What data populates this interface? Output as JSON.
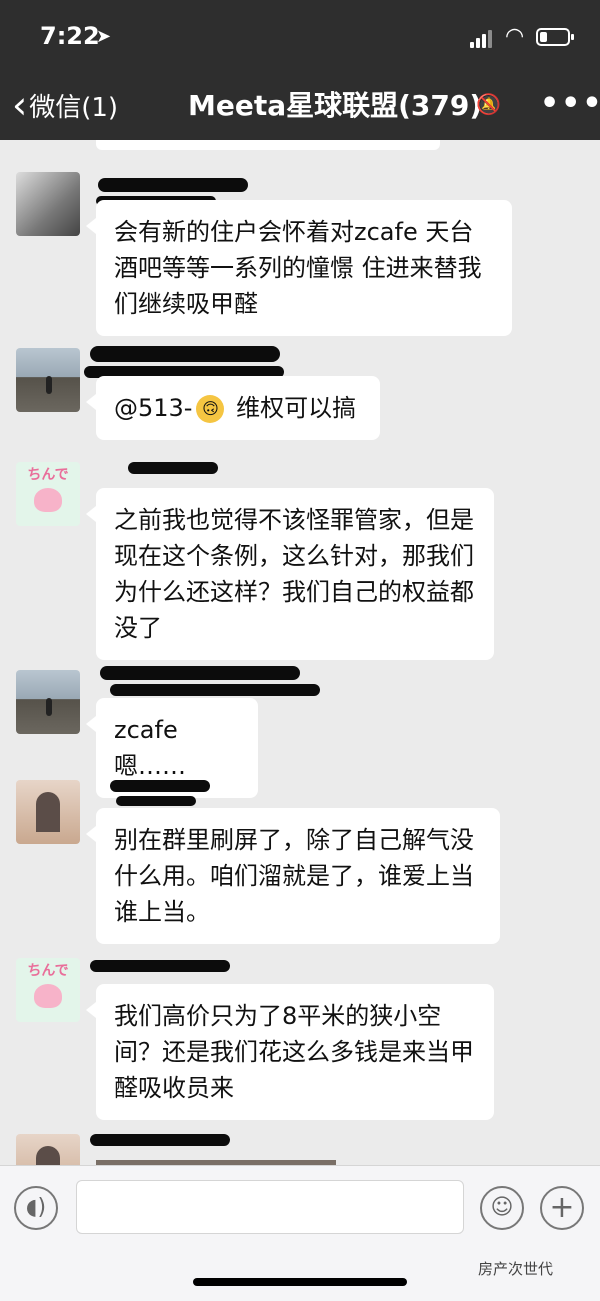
{
  "status": {
    "time": "7:22",
    "location_icon": "location-arrow-icon",
    "battery_level": 0.25
  },
  "nav": {
    "back_label": "微信(1)",
    "title": "Meeta星球联盟(379)",
    "mute_icon": "ear-muted-icon",
    "more_icon": "more-icon"
  },
  "messages": [
    {
      "avatar": "cat",
      "text": "会有新的住户会怀着对zcafe 天台酒吧等等一系列的憧憬 住进来替我们继续吸甲醛"
    },
    {
      "avatar": "road",
      "text_before": "@513-",
      "emoji": "upside-down-face",
      "text_after": " 维权可以搞"
    },
    {
      "avatar": "crayon",
      "avatar_text": "ちんで",
      "text": "之前我也觉得不该怪罪管家，但是现在这个条例，这么针对，那我们为什么还这样？我们自己的权益都没了"
    },
    {
      "avatar": "road",
      "text": "zcafe嗯……"
    },
    {
      "avatar": "church",
      "text": " 别在群里刷屏了，除了自己解气没什么用。咱们溜就是了，谁爱上当谁上当。"
    },
    {
      "avatar": "crayon",
      "avatar_text": "ちんで",
      "text": "我们高价只为了8平米的狭小空间？还是我们花这么多钱是来当甲醛吸收员来"
    }
  ],
  "input": {
    "voice_icon": "voice-icon",
    "emoji_icon": "smiley-icon",
    "plus_icon": "plus-icon"
  },
  "watermark": "房产次世代"
}
